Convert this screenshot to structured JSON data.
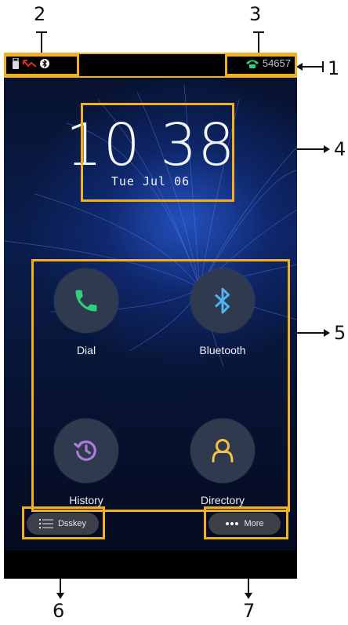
{
  "status_bar": {
    "extension": "54657",
    "icons": [
      "usb-icon",
      "missed-call-icon",
      "bluetooth-icon"
    ],
    "line_icon": "phone-line-icon"
  },
  "clock": {
    "time": "10 38",
    "date": "Tue Jul 06"
  },
  "apps": [
    {
      "label": "Dial",
      "icon": "phone-icon",
      "color": "#2fd07a"
    },
    {
      "label": "Bluetooth",
      "icon": "bluetooth-icon",
      "color": "#4fb2f5"
    },
    {
      "label": "History",
      "icon": "history-icon",
      "color": "#b07ae0"
    },
    {
      "label": "Directory",
      "icon": "directory-icon",
      "color": "#f3c04a"
    }
  ],
  "softkeys": {
    "left": "Dsskey",
    "right": "More"
  },
  "callouts": [
    "1",
    "2",
    "3",
    "4",
    "5",
    "6",
    "7"
  ],
  "colors": {
    "highlight": "#f0b022",
    "missed_call": "#e02a2a",
    "line_status": "#2fd07a"
  }
}
